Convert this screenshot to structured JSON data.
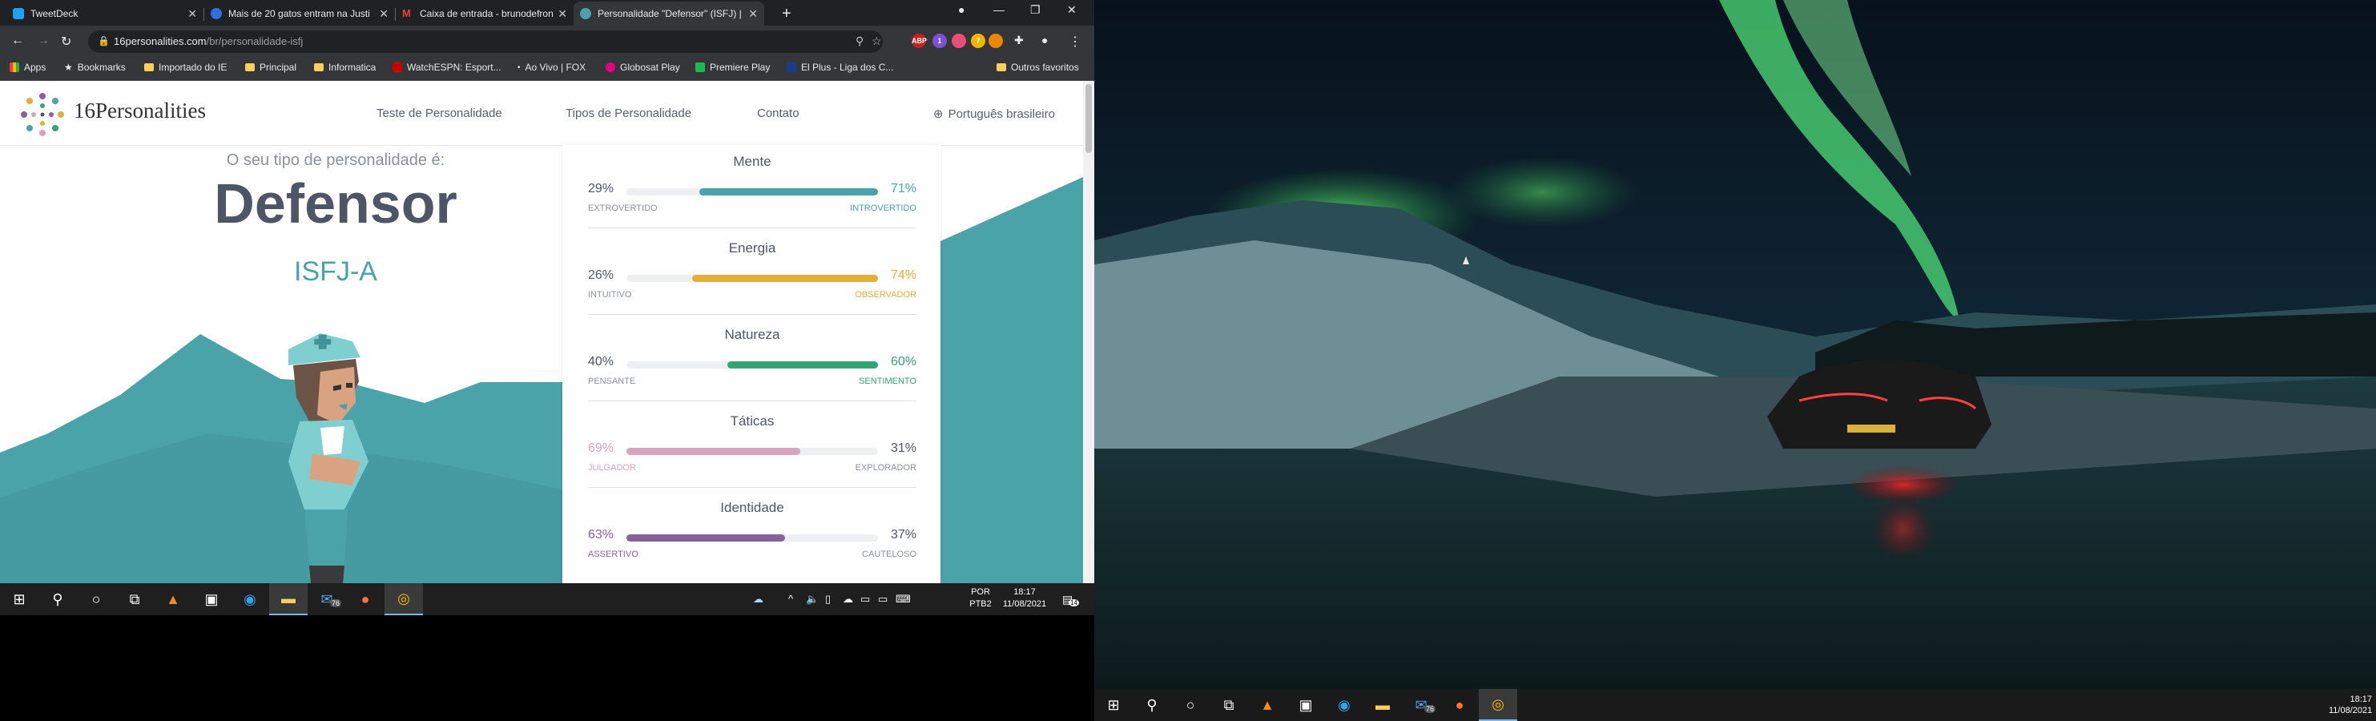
{
  "browser": {
    "tabs": [
      {
        "title": "TweetDeck",
        "color": "#1da1f2"
      },
      {
        "title": "Mais de 20 gatos entram na Justi",
        "color": "#2f6fe0"
      },
      {
        "title": "Caixa de entrada - brunodefronte",
        "color": "#ea4335"
      },
      {
        "title": "Personalidade \"Defensor\" (ISFJ) |",
        "color": "#4aa3a8"
      }
    ],
    "url_host": "16personalities.com",
    "url_path": "/br/personalidade-isfj",
    "extensions": [
      "ABP",
      "1",
      "",
      "7"
    ],
    "bookmarks": [
      {
        "label": "Apps",
        "icon": "apps-icon"
      },
      {
        "label": "Bookmarks",
        "icon": "star-icon"
      },
      {
        "label": "Importado do IE",
        "icon": "folder-icon"
      },
      {
        "label": "Principal",
        "icon": "folder-icon"
      },
      {
        "label": "Informatica",
        "icon": "folder-icon"
      },
      {
        "label": "WatchESPN: Esport...",
        "icon": "espn-icon"
      },
      {
        "label": "Ao Vivo | FOX",
        "icon": "fox-icon"
      },
      {
        "label": "Globosat Play",
        "icon": "globosat-icon"
      },
      {
        "label": "Premiere Play",
        "icon": "premiere-icon"
      },
      {
        "label": "El Plus - Liga dos C...",
        "icon": "elplus-icon"
      },
      {
        "label": "Outros favoritos",
        "icon": "folder-icon"
      }
    ]
  },
  "site": {
    "logo": "16Personalities",
    "nav": [
      "Teste de Personalidade",
      "Tipos de Personalidade",
      "Contato"
    ],
    "language": "Português brasileiro"
  },
  "hero": {
    "subtitle": "O seu tipo de personalidade é:",
    "title": "Defensor",
    "code": "ISFJ-A"
  },
  "traits": [
    {
      "name": "Mente",
      "left_pct": "29%",
      "right_pct": "71%",
      "left_label": "EXTROVERTIDO",
      "right_label": "INTROVERTIDO",
      "value": 0.71,
      "side": "right",
      "color": "#4aa3a8"
    },
    {
      "name": "Energia",
      "left_pct": "26%",
      "right_pct": "74%",
      "left_label": "INTUITIVO",
      "right_label": "OBSERVADOR",
      "value": 0.74,
      "side": "right",
      "color": "#e4ae3a"
    },
    {
      "name": "Natureza",
      "left_pct": "40%",
      "right_pct": "60%",
      "left_label": "PENSANTE",
      "right_label": "SENTIMENTO",
      "value": 0.6,
      "side": "right",
      "color": "#33a474"
    },
    {
      "name": "Táticas",
      "left_pct": "69%",
      "right_pct": "31%",
      "left_label": "JULGADOR",
      "right_label": "EXPLORADOR",
      "value": 0.69,
      "side": "left",
      "color": "#d6a3c1"
    },
    {
      "name": "Identidade",
      "left_pct": "63%",
      "right_pct": "37%",
      "left_label": "ASSERTIVO",
      "right_label": "CAUTELOSO",
      "value": 0.63,
      "side": "left",
      "color": "#88619a"
    }
  ],
  "taskbar_left": {
    "mail_badge": "76",
    "lang": "POR",
    "layout": "PTB2",
    "time": "18:17",
    "date": "11/08/2021",
    "notif_count": "14"
  },
  "taskbar_right": {
    "mail_badge": "76",
    "time": "18:17",
    "date": "11/08/2021"
  }
}
